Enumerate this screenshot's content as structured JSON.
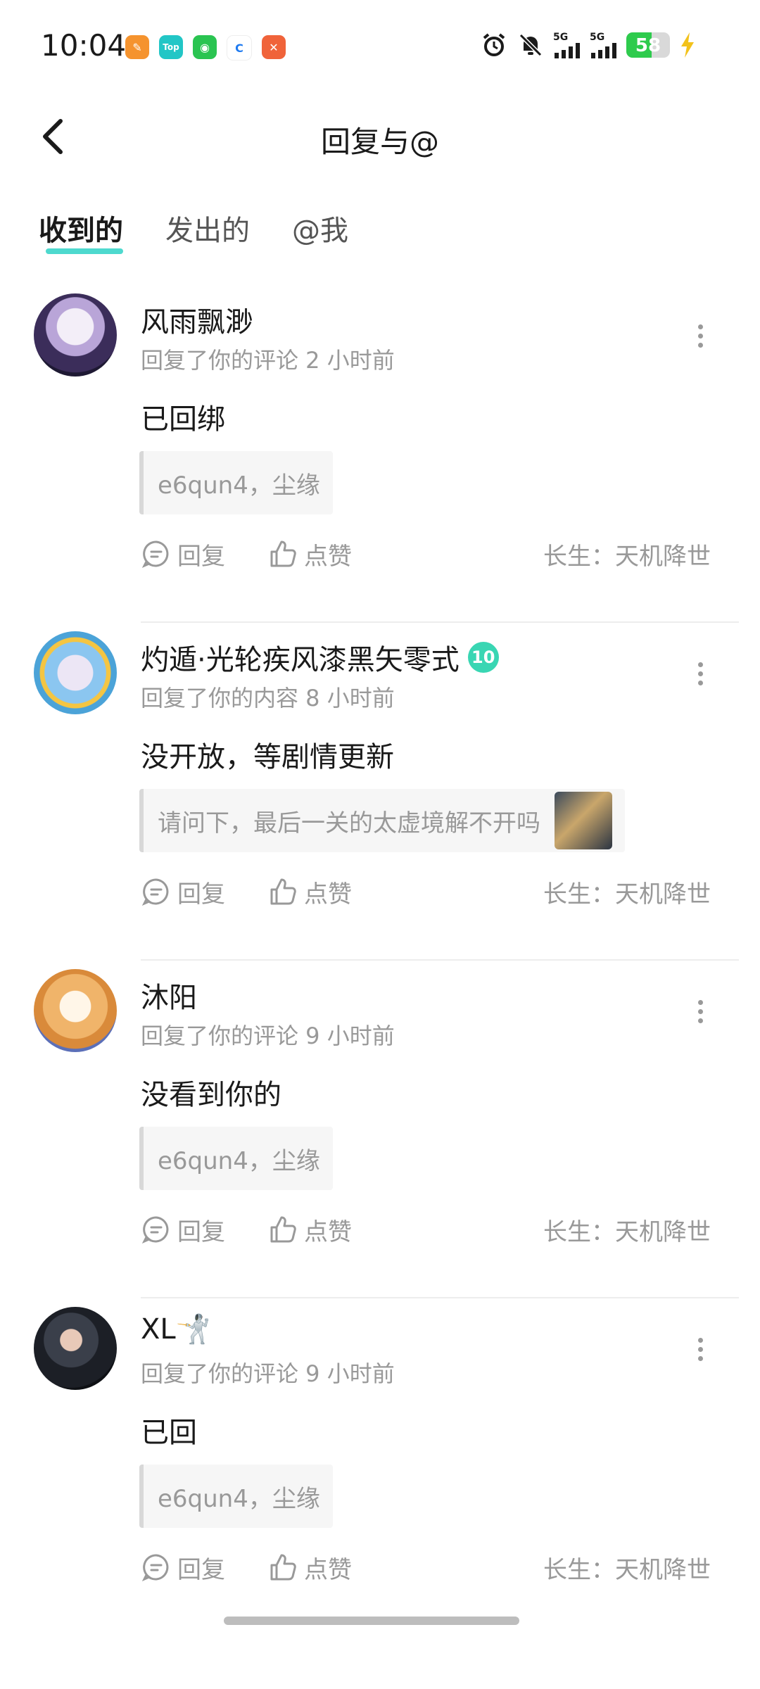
{
  "status_bar": {
    "time": "10:04",
    "battery": "58",
    "battery_level": 0.58,
    "signal_label_1": "5G",
    "signal_label_2": "5G",
    "app_icons": [
      "app-icon-orange",
      "app-icon-top",
      "wechat-icon",
      "app-icon-blue",
      "app-icon-red"
    ],
    "app_icon_text_top": "Top"
  },
  "header": {
    "title": "回复与@"
  },
  "tabs": [
    {
      "label": "收到的",
      "active": true
    },
    {
      "label": "发出的",
      "active": false
    },
    {
      "label": "@我",
      "active": false
    }
  ],
  "items": [
    {
      "name": "风雨飘渺",
      "meta": "回复了你的评论 2 小时前",
      "content": "已回绑",
      "quote": "e6qun4，尘缘",
      "reply_label": "回复",
      "like_label": "点赞",
      "source": "长生：天机降世"
    },
    {
      "name": "灼遁·光轮疾风漆黑矢零式",
      "badge": "10",
      "meta": "回复了你的内容 8 小时前",
      "content": "没开放，等剧情更新",
      "quote": "请问下，最后一关的太虚境解不开吗",
      "reply_label": "回复",
      "like_label": "点赞",
      "source": "长生：天机降世"
    },
    {
      "name": "沐阳",
      "meta": "回复了你的评论 9 小时前",
      "content": "没看到你的",
      "quote": "e6qun4，尘缘",
      "reply_label": "回复",
      "like_label": "点赞",
      "source": "长生：天机降世"
    },
    {
      "name": "XL🤺",
      "meta": "回复了你的评论 9 小时前",
      "content": "已回",
      "quote": "e6qun4，尘缘",
      "reply_label": "回复",
      "like_label": "点赞",
      "source": "长生：天机降世"
    }
  ],
  "colors": {
    "accent": "#2fd2c6",
    "badge": "#39d6b3",
    "battery": "#2ecb4d"
  }
}
